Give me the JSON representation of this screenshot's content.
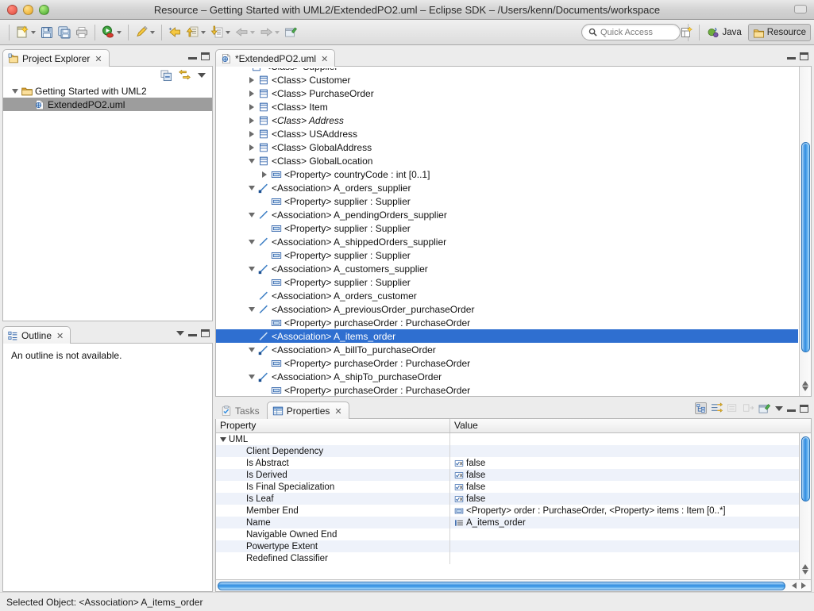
{
  "window": {
    "title": "Resource – Getting Started with UML2/ExtendedPO2.uml – Eclipse SDK – /Users/kenn/Documents/workspace",
    "traffic_lights": [
      "close-red",
      "minimize-yellow",
      "zoom-green"
    ]
  },
  "toolbar": {
    "buttons": [
      {
        "name": "new-wizard",
        "icon": "new-file-icon",
        "has_menu": true
      },
      {
        "name": "save",
        "icon": "save-icon",
        "has_menu": false
      },
      {
        "name": "save-all",
        "icon": "save-all-icon",
        "has_menu": false
      },
      {
        "name": "print",
        "icon": "print-icon",
        "has_menu": false
      },
      {
        "name": "run",
        "icon": "run-icon",
        "has_menu": true
      },
      {
        "name": "search",
        "icon": "pencil-search-icon",
        "has_menu": true
      },
      {
        "name": "previous-annotation",
        "icon": "back-arrow-yellow-icon",
        "has_menu": false
      },
      {
        "name": "next-annotation",
        "icon": "up-arrow-icon",
        "has_menu": true
      },
      {
        "name": "last-edit-location",
        "icon": "down-arrow-icon",
        "has_menu": true
      },
      {
        "name": "back",
        "icon": "back-grey-icon",
        "has_menu": true
      },
      {
        "name": "forward",
        "icon": "forward-grey-icon",
        "has_menu": true
      },
      {
        "name": "new-editor",
        "icon": "new-editor-icon",
        "has_menu": false
      }
    ],
    "quick_access_placeholder": "Quick Access",
    "quick_access_value": "",
    "open_perspective_tooltip": "Open Perspective",
    "perspectives": [
      {
        "label": "Java",
        "icon": "java-perspective-icon",
        "active": false
      },
      {
        "label": "Resource",
        "icon": "resource-perspective-icon",
        "active": true
      }
    ]
  },
  "project_explorer": {
    "tab_label": "Project Explorer",
    "close_glyph": "✕",
    "view_tools": [
      {
        "name": "collapse-all-icon"
      },
      {
        "name": "link-with-editor-icon"
      },
      {
        "name": "view-menu-icon"
      }
    ],
    "tree": [
      {
        "label": "Getting Started with UML2",
        "icon": "project-folder-icon",
        "twist": "down",
        "indent": 0,
        "selected": false
      },
      {
        "label": "ExtendedPO2.uml",
        "icon": "uml-model-icon",
        "twist": "none",
        "indent": 1,
        "selected": true
      }
    ]
  },
  "outline": {
    "tab_label": "Outline",
    "close_glyph": "✕",
    "message": "An outline is not available."
  },
  "editor": {
    "tab_label": "*ExtendedPO2.uml",
    "tab_icon": "uml-model-icon",
    "close_glyph": "✕",
    "tree": [
      {
        "label": "<Class> Customer",
        "icon": "class-icon",
        "twist": "right",
        "indent": 1,
        "italic": false,
        "selected": false
      },
      {
        "label": "<Class> PurchaseOrder",
        "icon": "class-icon",
        "twist": "right",
        "indent": 1,
        "italic": false,
        "selected": false
      },
      {
        "label": "<Class> Item",
        "icon": "class-icon",
        "twist": "right",
        "indent": 1,
        "italic": false,
        "selected": false
      },
      {
        "label": "<Class> Address",
        "icon": "class-icon",
        "twist": "right",
        "indent": 1,
        "italic": true,
        "selected": false
      },
      {
        "label": "<Class> USAddress",
        "icon": "class-icon",
        "twist": "right",
        "indent": 1,
        "italic": false,
        "selected": false
      },
      {
        "label": "<Class> GlobalAddress",
        "icon": "class-icon",
        "twist": "right",
        "indent": 1,
        "italic": false,
        "selected": false
      },
      {
        "label": "<Class> GlobalLocation",
        "icon": "class-icon",
        "twist": "down",
        "indent": 1,
        "italic": false,
        "selected": false
      },
      {
        "label": "<Property> countryCode : int [0..1]",
        "icon": "property-icon",
        "twist": "right",
        "indent": 2,
        "italic": false,
        "selected": false
      },
      {
        "label": "<Association> A_orders_supplier",
        "icon": "association-agg-icon",
        "twist": "down",
        "indent": 1,
        "italic": false,
        "selected": false
      },
      {
        "label": "<Property> supplier : Supplier",
        "icon": "property-icon",
        "twist": "none",
        "indent": 2,
        "italic": false,
        "selected": false
      },
      {
        "label": "<Association> A_pendingOrders_supplier",
        "icon": "association-icon",
        "twist": "down",
        "indent": 1,
        "italic": false,
        "selected": false
      },
      {
        "label": "<Property> supplier : Supplier",
        "icon": "property-icon",
        "twist": "none",
        "indent": 2,
        "italic": false,
        "selected": false
      },
      {
        "label": "<Association> A_shippedOrders_supplier",
        "icon": "association-icon",
        "twist": "down",
        "indent": 1,
        "italic": false,
        "selected": false
      },
      {
        "label": "<Property> supplier : Supplier",
        "icon": "property-icon",
        "twist": "none",
        "indent": 2,
        "italic": false,
        "selected": false
      },
      {
        "label": "<Association> A_customers_supplier",
        "icon": "association-agg-icon",
        "twist": "down",
        "indent": 1,
        "italic": false,
        "selected": false
      },
      {
        "label": "<Property> supplier : Supplier",
        "icon": "property-icon",
        "twist": "none",
        "indent": 2,
        "italic": false,
        "selected": false
      },
      {
        "label": "<Association> A_orders_customer",
        "icon": "association-icon",
        "twist": "none",
        "indent": 1,
        "italic": false,
        "selected": false
      },
      {
        "label": "<Association> A_previousOrder_purchaseOrder",
        "icon": "association-icon",
        "twist": "down",
        "indent": 1,
        "italic": false,
        "selected": false
      },
      {
        "label": "<Property> purchaseOrder : PurchaseOrder",
        "icon": "property-icon",
        "twist": "none",
        "indent": 2,
        "italic": false,
        "selected": false
      },
      {
        "label": "<Association> A_items_order",
        "icon": "association-sel-icon",
        "twist": "none",
        "indent": 1,
        "italic": false,
        "selected": true
      },
      {
        "label": "<Association> A_billTo_purchaseOrder",
        "icon": "association-agg-icon",
        "twist": "down",
        "indent": 1,
        "italic": false,
        "selected": false
      },
      {
        "label": "<Property> purchaseOrder : PurchaseOrder",
        "icon": "property-icon",
        "twist": "none",
        "indent": 2,
        "italic": false,
        "selected": false
      },
      {
        "label": "<Association> A_shipTo_purchaseOrder",
        "icon": "association-agg-icon",
        "twist": "down",
        "indent": 1,
        "italic": false,
        "selected": false
      },
      {
        "label": "<Property> purchaseOrder : PurchaseOrder",
        "icon": "property-icon",
        "twist": "none",
        "indent": 2,
        "italic": false,
        "selected": false
      }
    ]
  },
  "bottom_panel": {
    "tabs": [
      {
        "label": "Tasks",
        "icon": "tasks-icon",
        "active": false
      },
      {
        "label": "Properties",
        "icon": "properties-icon",
        "active": true
      }
    ],
    "close_glyph": "✕",
    "view_tools": [
      {
        "name": "show-categories-icon",
        "enabled": true
      },
      {
        "name": "show-advanced-icon",
        "enabled": true
      },
      {
        "name": "restore-default-value-icon",
        "enabled": false
      },
      {
        "name": "show-description-icon",
        "enabled": false
      },
      {
        "name": "pin-to-selection-icon",
        "enabled": true
      }
    ],
    "columns": [
      "Property",
      "Value"
    ],
    "group_label": "UML",
    "rows": [
      {
        "property": "Client Dependency",
        "value": "",
        "value_icon": ""
      },
      {
        "property": "Is Abstract",
        "value": "false",
        "value_icon": "boolean-icon"
      },
      {
        "property": "Is Derived",
        "value": "false",
        "value_icon": "boolean-icon"
      },
      {
        "property": "Is Final Specialization",
        "value": "false",
        "value_icon": "boolean-icon"
      },
      {
        "property": "Is Leaf",
        "value": "false",
        "value_icon": "boolean-icon"
      },
      {
        "property": "Member End",
        "value": "<Property> order : PurchaseOrder, <Property> items : Item [0..*]",
        "value_icon": "property-icon"
      },
      {
        "property": "Name",
        "value": "A_items_order",
        "value_icon": "text-icon"
      },
      {
        "property": "Navigable Owned End",
        "value": "",
        "value_icon": ""
      },
      {
        "property": "Powertype Extent",
        "value": "",
        "value_icon": ""
      },
      {
        "property": "Redefined Classifier",
        "value": "",
        "value_icon": ""
      }
    ]
  },
  "statusbar": {
    "text": "Selected Object: <Association> A_items_order"
  },
  "colors": {
    "selection_blue": "#2f6fd0",
    "selection_grey": "#9d9d9d",
    "scrollbar_blue": "#2f8ce0",
    "row_alt": "#eef2fa",
    "uml_icon_blue": "#2b5fa8"
  }
}
